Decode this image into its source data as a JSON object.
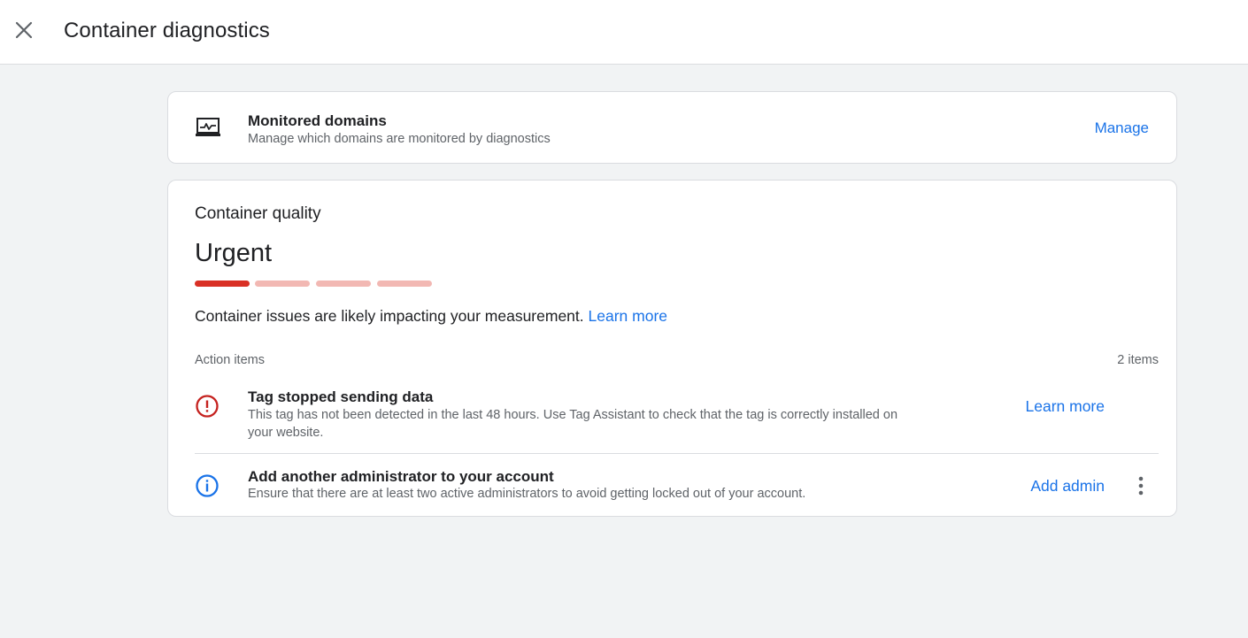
{
  "header": {
    "title": "Container diagnostics",
    "close_icon": "close-icon"
  },
  "monitored_domains": {
    "icon": "monitor-chart-icon",
    "title": "Monitored domains",
    "subtitle": "Manage which domains are monitored by diagnostics",
    "action_label": "Manage"
  },
  "quality": {
    "label": "Container quality",
    "status": "Urgent",
    "status_level": 1,
    "status_levels_total": 4,
    "status_color": "#d93025",
    "message": "Container issues are likely impacting your measurement.",
    "message_link": "Learn more",
    "action_items_label": "Action items",
    "action_items_count": "2 items",
    "items": [
      {
        "icon": "error-icon",
        "title": "Tag stopped sending data",
        "description": "This tag has not been detected in the last 48 hours. Use Tag Assistant to check that the tag is correctly installed on your website.",
        "action_label": "Learn more"
      },
      {
        "icon": "info-icon",
        "title": "Add another administrator to your account",
        "description": "Ensure that there are at least two active administrators to avoid getting locked out of your account.",
        "action_label": "Add admin",
        "more_icon": "more-vert-icon"
      }
    ]
  }
}
